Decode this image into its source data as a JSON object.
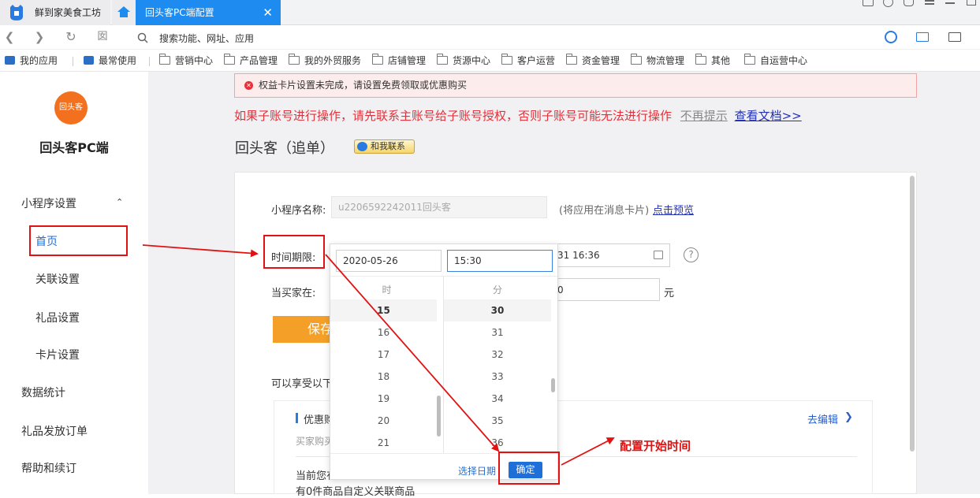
{
  "tabs": {
    "first": "鲜到家美食工坊",
    "active": "回头客PC端配置",
    "close": "✕"
  },
  "address": {
    "placeholder": "搜索功能、网址、应用"
  },
  "bookmarks": [
    "我的应用",
    "最常使用",
    "营销中心",
    "产品管理",
    "我的外贸服务",
    "店铺管理",
    "货源中心",
    "客户运营",
    "资金管理",
    "物流管理",
    "其他",
    "自运营中心"
  ],
  "sidebar": {
    "app_title": "回头客PC端",
    "logo_text": "回头客",
    "section": "小程序设置",
    "items": [
      "首页",
      "关联设置",
      "礼品设置",
      "卡片设置"
    ],
    "others": [
      "数据统计",
      "礼品发放订单",
      "帮助和续订"
    ]
  },
  "notice": {
    "text": "权益卡片设置未完成，请设置免费领取或优惠购买"
  },
  "warning": {
    "text": "如果子账号进行操作，请先联系主账号给子账号授权，否则子账号可能无法进行操作",
    "dismiss": "不再提示",
    "doc_link": "查看文档>>"
  },
  "page": {
    "title": "回头客（追单）",
    "contact": "和我联系"
  },
  "form": {
    "name_label": "小程序名称:",
    "name_value": "u2206592242011回头客",
    "name_hint": "(将应用在消息卡片)",
    "preview_link": "点击预览",
    "period_label": "时间期限:",
    "end_partial": "31 16:36",
    "buyer_label": "当买家在:",
    "buyer_value_partial": "0",
    "unit": "元",
    "save_label": "保存",
    "enjoy_label": "可以享受以下",
    "section_title": "优惠购",
    "section_sub": "买家购买",
    "edit_link": "去编辑",
    "current_text": "当前您有",
    "count_text": "有0件商品自定义关联商品"
  },
  "picker": {
    "date": "2020-05-26",
    "time": "15:30",
    "hour_label": "时",
    "minute_label": "分",
    "hours": [
      "15",
      "16",
      "17",
      "18",
      "19",
      "20",
      "21"
    ],
    "minutes": [
      "30",
      "31",
      "32",
      "33",
      "34",
      "35",
      "36"
    ],
    "choose_date": "选择日期",
    "confirm": "确定"
  },
  "annotation": {
    "text": "配置开始时间"
  }
}
